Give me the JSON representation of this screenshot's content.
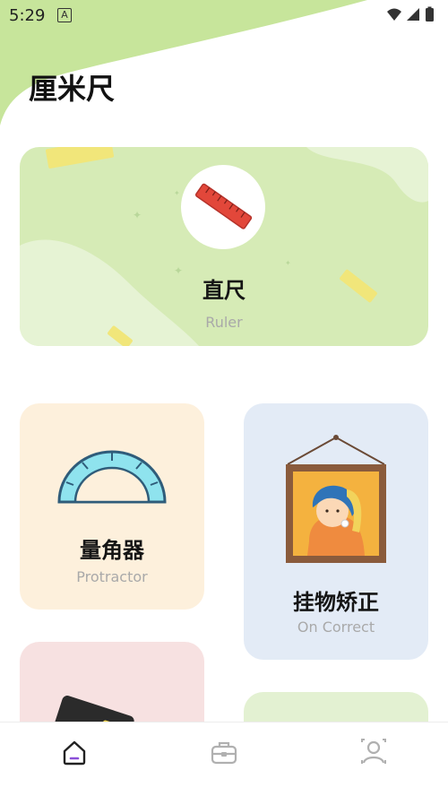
{
  "status": {
    "time": "5:29",
    "notification_letter": "A"
  },
  "page": {
    "title": "厘米尺"
  },
  "cards": {
    "ruler": {
      "title": "直尺",
      "subtitle": "Ruler"
    },
    "protractor": {
      "title": "量角器",
      "subtitle": "Protractor"
    },
    "picture": {
      "title": "挂物矫正",
      "subtitle": "On Correct"
    }
  },
  "nav": {
    "items": [
      "home-icon",
      "toolbox-icon",
      "profile-icon"
    ],
    "active": "home-icon"
  },
  "colors": {
    "accent_green": "#c7e59b",
    "active_indicator": "#8a4fd8"
  }
}
